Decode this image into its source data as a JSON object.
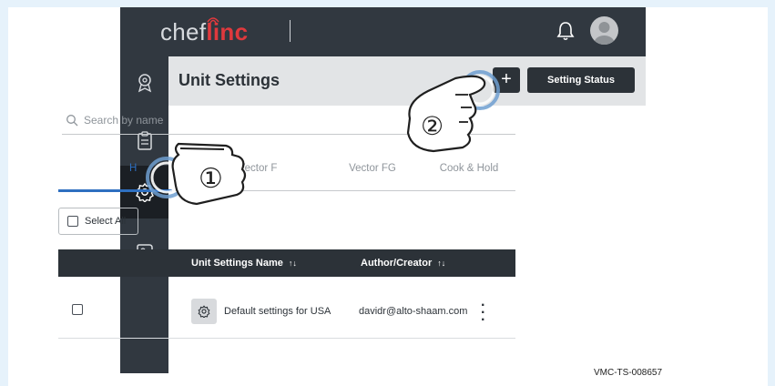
{
  "app": {
    "logo_prefix": "chef",
    "logo_brand": "linc"
  },
  "header": {
    "title": "Unit Settings",
    "add_label": "+",
    "status_button": "Setting Status"
  },
  "search": {
    "placeholder": "Search by name"
  },
  "tabs": [
    {
      "label": "H",
      "active": true
    },
    {
      "label": "Vector F",
      "active": false
    },
    {
      "label": "Vector FG",
      "active": false
    },
    {
      "label": "Cook & Hold",
      "active": false
    }
  ],
  "select_all": "Select All",
  "table": {
    "columns": [
      "Unit Settings Name",
      "Author/Creator"
    ],
    "sort_glyph": "↑↓",
    "rows": [
      {
        "name": "Default settings for USA",
        "author": "davidr@alto-shaam.com"
      }
    ]
  },
  "callouts": [
    "①",
    "②"
  ],
  "watermark": "VMC-TS-008657",
  "colors": {
    "dark_bar": "#313840",
    "accent_red": "#e0393d",
    "tab_active": "#2e6fc0"
  },
  "icons": {
    "sidebar": [
      "location-badge-icon",
      "clipboard-icon",
      "gear-icon",
      "tag-icon"
    ],
    "top": [
      "bell-icon",
      "avatar-icon"
    ]
  }
}
